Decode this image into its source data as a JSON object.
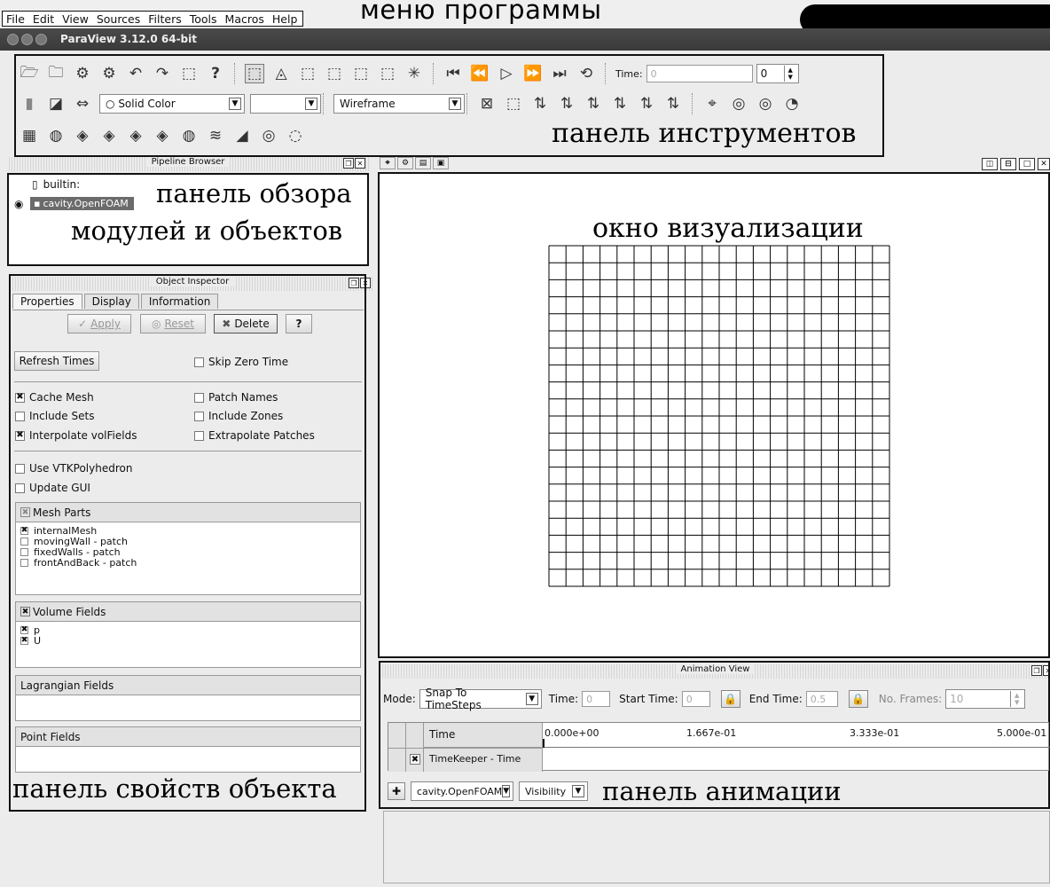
{
  "menu": {
    "items": [
      "File",
      "Edit",
      "View",
      "Sources",
      "Filters",
      "Tools",
      "Macros",
      "Help"
    ],
    "annotation": "меню программы"
  },
  "window": {
    "title": "ParaView 3.12.0 64-bit"
  },
  "toolbar": {
    "annotation": "панель инструментов",
    "time_label": "Time:",
    "time_value": "0",
    "time_index": "0",
    "color_combo": "Solid Color",
    "representation_combo": "Wireframe"
  },
  "pipeline": {
    "title": "Pipeline Browser",
    "items": [
      "builtin:",
      "cavity.OpenFOAM"
    ],
    "annotation_line1": "панель обзора",
    "annotation_line2": "модулей и объектов"
  },
  "inspector": {
    "title": "Object Inspector",
    "tabs": [
      "Properties",
      "Display",
      "Information"
    ],
    "buttons": {
      "apply": "Apply",
      "reset": "Reset",
      "delete": "Delete",
      "help": "?"
    },
    "refresh_times": "Refresh Times",
    "options": [
      {
        "label": "Skip Zero Time",
        "checked": false
      },
      {
        "label": "Cache Mesh",
        "checked": true
      },
      {
        "label": "Patch Names",
        "checked": false
      },
      {
        "label": "Include Sets",
        "checked": false
      },
      {
        "label": "Include Zones",
        "checked": false
      },
      {
        "label": "Interpolate volFields",
        "checked": true
      },
      {
        "label": "Extrapolate Patches",
        "checked": false
      },
      {
        "label": "Use VTKPolyhedron",
        "checked": false
      },
      {
        "label": "Update GUI",
        "checked": false
      }
    ],
    "mesh_parts": {
      "header": "Mesh Parts",
      "items": [
        {
          "label": "internalMesh",
          "checked": true
        },
        {
          "label": "movingWall - patch",
          "checked": false
        },
        {
          "label": "fixedWalls - patch",
          "checked": false
        },
        {
          "label": "frontAndBack - patch",
          "checked": false
        }
      ]
    },
    "volume_fields": {
      "header": "Volume Fields",
      "items": [
        {
          "label": "p",
          "checked": true
        },
        {
          "label": "U",
          "checked": true
        }
      ]
    },
    "lagrangian_fields": "Lagrangian Fields",
    "point_fields": "Point Fields",
    "annotation": "панель свойств объекта"
  },
  "viz": {
    "annotation": "окно визуализации",
    "grid_cells": 20
  },
  "animation": {
    "title": "Animation View",
    "mode_label": "Mode:",
    "mode_value": "Snap To TimeSteps",
    "time_label": "Time:",
    "time_value": "0",
    "start_label": "Start Time:",
    "start_value": "0",
    "end_label": "End Time:",
    "end_value": "0.5",
    "frames_label": "No. Frames:",
    "frames_value": "10",
    "col_time": "Time",
    "ticks": [
      "0.000e+00",
      "1.667e-01",
      "3.333e-01",
      "5.000e-01"
    ],
    "track": "TimeKeeper - Time",
    "source_combo": "cavity.OpenFOAM",
    "property_combo": "Visibility",
    "annotation": "панель анимации"
  }
}
